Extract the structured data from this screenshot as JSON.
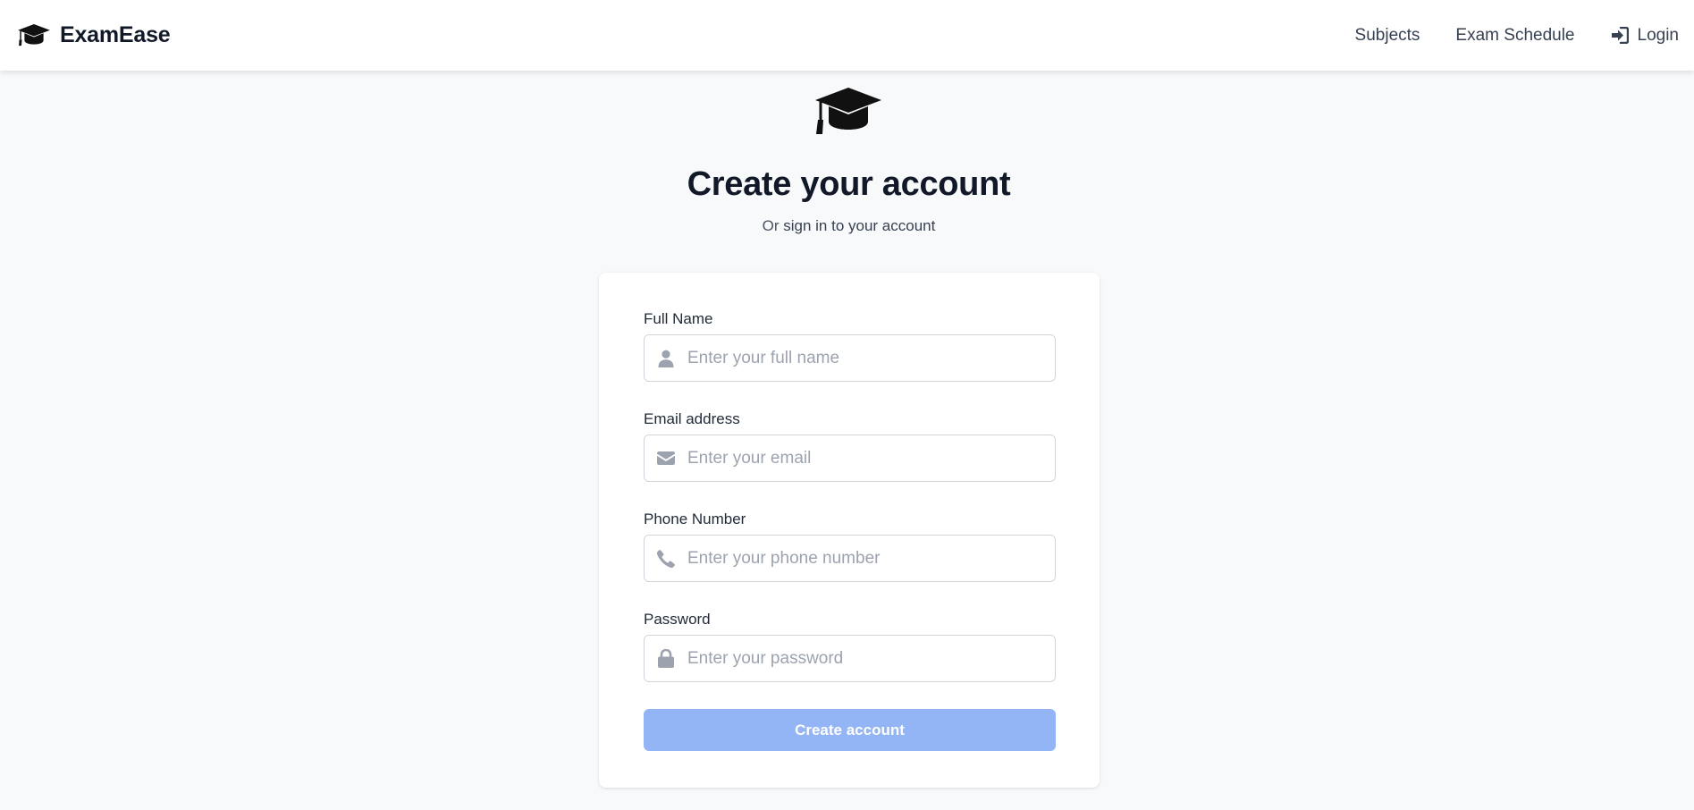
{
  "brand": {
    "name": "ExamEase",
    "icon": "graduation-cap-icon"
  },
  "nav": {
    "links": [
      {
        "label": "Subjects"
      },
      {
        "label": "Exam Schedule"
      },
      {
        "label": "Login",
        "icon": "sign-in-icon"
      }
    ]
  },
  "hero": {
    "icon": "graduation-cap-icon",
    "title": "Create your account",
    "subtitle_prefix": "Or",
    "subtitle_link": "sign in to your account"
  },
  "form": {
    "fields": [
      {
        "label": "Full Name",
        "placeholder": "Enter your full name",
        "value": "",
        "icon": "user-icon"
      },
      {
        "label": "Email address",
        "placeholder": "Enter your email",
        "value": "",
        "icon": "envelope-icon"
      },
      {
        "label": "Phone Number",
        "placeholder": "Enter your phone number",
        "value": "",
        "icon": "phone-icon"
      },
      {
        "label": "Password",
        "placeholder": "Enter your password",
        "value": "",
        "icon": "lock-icon"
      }
    ],
    "submit_label": "Create account"
  },
  "colors": {
    "background": "#f8f9fb",
    "card": "#ffffff",
    "button": "#93b4f5",
    "icon_gray": "#9ca3af",
    "text_dark": "#111827"
  }
}
